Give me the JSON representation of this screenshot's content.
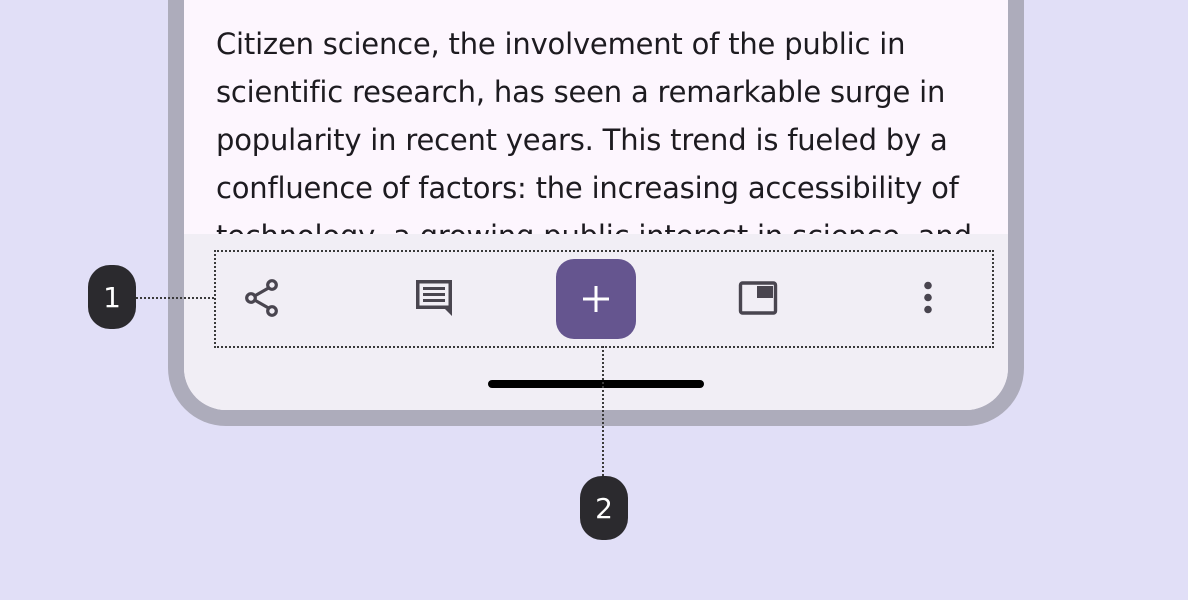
{
  "article": {
    "text": "Citizen science, the involvement of the public in scientific research, has seen a remarkable surge in popularity in recent years. This trend is fueled by a confluence of factors: the increasing accessibility of technology, a growing public interest in science, and"
  },
  "toolbar": {
    "items": [
      {
        "icon": "share-icon"
      },
      {
        "icon": "comment-icon"
      },
      {
        "icon": "add-icon"
      },
      {
        "icon": "picture-in-picture-icon"
      },
      {
        "icon": "more-vert-icon"
      }
    ]
  },
  "callouts": {
    "toolbar_label": "1",
    "fab_label": "2"
  },
  "colors": {
    "background": "#e1dff7",
    "frame": "#adacbb",
    "screen": "#fdf6fe",
    "toolbar_surface": "#f1eef5",
    "fab": "#65558f",
    "icon": "#49454f",
    "callout": "#2b2a2e"
  }
}
